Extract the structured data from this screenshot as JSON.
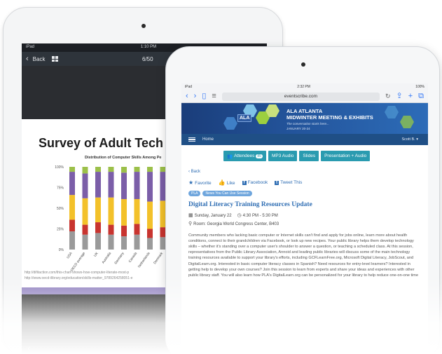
{
  "back_tablet": {
    "status": {
      "left": "iPad",
      "time": "1:10 PM"
    },
    "nav": {
      "back_label": "Back",
      "page_counter": "6/50"
    },
    "slide": {
      "title": "Survey of Adult Tech",
      "chart_caption": "Distribution of Computer Skills Among Pe",
      "url_1": "http://difitaction.com/this-chart-shows-how-computer-literate-most-p",
      "url_2": "http://www.oecd-ilibrary.org/education/skills-matter_9789264258051-e"
    }
  },
  "chart_data": {
    "type": "bar",
    "title": "Distribution of Computer Skills Among Pe",
    "categories": [
      "USA",
      "OECD average",
      "UK",
      "Australia",
      "Germany",
      "Canada",
      "Netherlands",
      "Denmark"
    ],
    "yticks": [
      "100%",
      "75%",
      "50%",
      "25%",
      "0%"
    ],
    "ylim": [
      0,
      100
    ],
    "series": [
      {
        "color": "#9a9a9a",
        "values": [
          22,
          18,
          20,
          18,
          16,
          18,
          14,
          15
        ]
      },
      {
        "color": "#c8342f",
        "values": [
          14,
          12,
          13,
          12,
          13,
          13,
          11,
          12
        ]
      },
      {
        "color": "#f3c12a",
        "values": [
          30,
          32,
          30,
          33,
          32,
          30,
          33,
          32
        ]
      },
      {
        "color": "#7b5ea8",
        "values": [
          28,
          30,
          31,
          31,
          32,
          33,
          36,
          35
        ]
      },
      {
        "color": "#9cc04a",
        "values": [
          6,
          8,
          6,
          6,
          7,
          6,
          6,
          6
        ]
      }
    ]
  },
  "front_tablet": {
    "status": {
      "left": "iPad",
      "time": "2:32 PM",
      "right": "100%"
    },
    "browser": {
      "url": "eventscribe.com"
    },
    "banner": {
      "logo": "ALA",
      "title_1": "ALA ATLANTA",
      "title_2": "MIDWINTER MEETING & EXHIBITS",
      "subtitle": "The conversation starts here...",
      "date": "JANUARY 20-24"
    },
    "subnav": {
      "home": "Home",
      "user": "Scott B. ▾"
    },
    "buttons": {
      "attendees": "Attendees",
      "attendees_count": "85",
      "mp3": "MP3 Audio",
      "slides": "Slides",
      "presentation": "Presentation + Audio"
    },
    "back_link": "‹ Back",
    "social": {
      "favorite": "Favorite",
      "like": "Like",
      "facebook": "Facebook",
      "tweet": "Tweet This"
    },
    "tags": [
      "PLA",
      "News You Can Use Session"
    ],
    "session": {
      "title": "Digital Literacy Training Resources Update",
      "date": "Sunday, January 22",
      "time": "4:30 PM - 5:30 PM",
      "room": "Room: Georgia World Congress Center, B403"
    },
    "description": "Community members who lacking basic computer or Internet skills can't find and apply for jobs online, learn more about health conditions, connect to their grandchildren via Facebook, or look up new recipes. Your public library helps them develop technology skills – whether it's standing over a computer user's shoulder to answer a question, or teaching a scheduled class. At this session, representatives from the Public Library Association, Annoid and leading public libraries will discuss some of the main technology training resources available to support your library's efforts, including GCFLearnFree.org, Microsoft Digital Literacy, JobScout, and DigitalLearn.org. Interested in basic computer literacy classes in Spanish? Need resources for entry-level learners? Interested in getting help to develop your own courses? Join this session to learn from experts and share your ideas and experiences with other public library staff. You will also learn how PLA's DigitalLearn.org can be personalized for your library to help reduce one-on-one time"
  }
}
